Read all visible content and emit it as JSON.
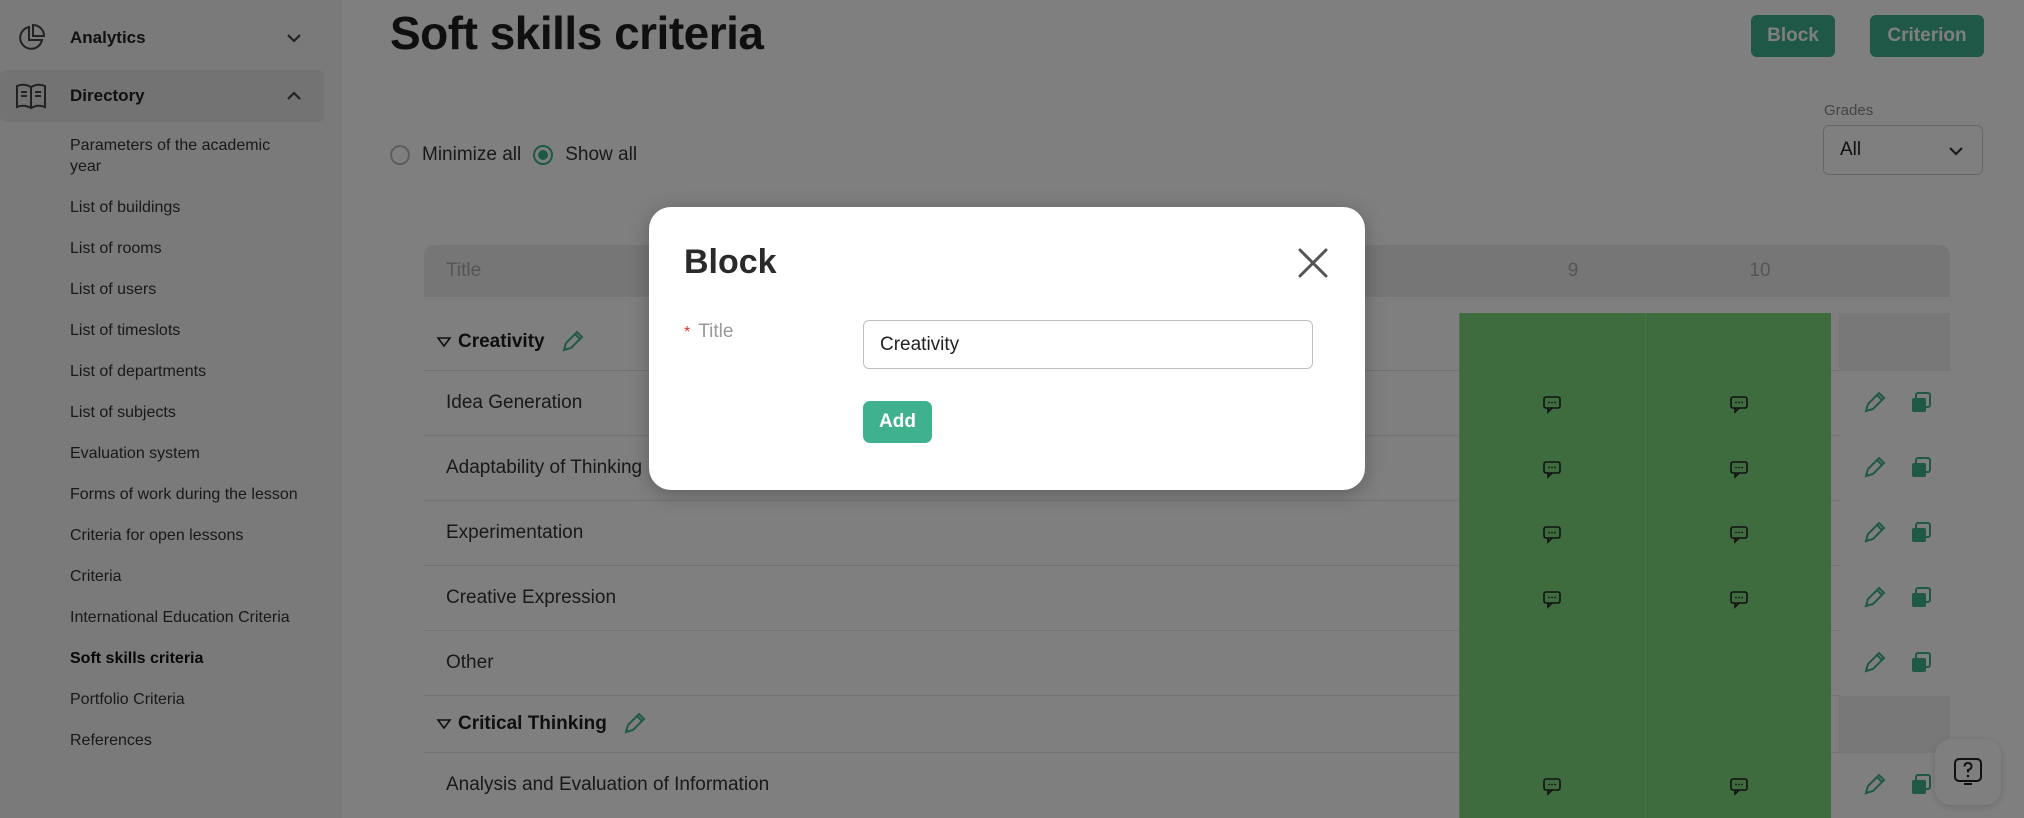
{
  "sidebar": {
    "groups": [
      {
        "label": "Analytics",
        "icon": "pie-chart-icon",
        "expanded": false
      },
      {
        "label": "Directory",
        "icon": "book-icon",
        "expanded": true
      }
    ],
    "items": [
      "Parameters of the academic year",
      "List of buildings",
      "List of rooms",
      "List of users",
      "List of timeslots",
      "List of departments",
      "List of subjects",
      "Evaluation system",
      "Forms of work during the lesson",
      "Criteria for open lessons",
      "Criteria",
      "International Education Criteria",
      "Soft skills criteria",
      "Portfolio Criteria",
      "References"
    ],
    "current_item": "Soft skills criteria"
  },
  "header": {
    "title": "Soft skills criteria",
    "block_button": "Block",
    "criterion_button": "Criterion"
  },
  "view_toggle": {
    "minimize_label": "Minimize all",
    "show_label": "Show all",
    "selected": "Show all"
  },
  "grades_filter": {
    "label": "Grades",
    "value": "All"
  },
  "table": {
    "title_header": "Title",
    "grade_columns": [
      "9",
      "10"
    ],
    "rows": [
      {
        "type": "block",
        "label": "Creativity"
      },
      {
        "type": "criterion",
        "label": "Idea Generation",
        "comments": true
      },
      {
        "type": "criterion",
        "label": "Adaptability of Thinking",
        "comments": true
      },
      {
        "type": "criterion",
        "label": "Experimentation",
        "comments": true
      },
      {
        "type": "criterion",
        "label": "Creative Expression",
        "comments": true
      },
      {
        "type": "criterion",
        "label": "Other",
        "comments": false
      },
      {
        "type": "block",
        "label": "Critical Thinking"
      },
      {
        "type": "criterion",
        "label": "Analysis and Evaluation of Information",
        "comments": true
      }
    ]
  },
  "modal": {
    "title": "Block",
    "field_label": "Title",
    "required_mark": "*",
    "field_value": "Creativity",
    "add_button": "Add"
  },
  "colors": {
    "accent": "#3fb18f",
    "grade_cell": "#7fd87f"
  }
}
